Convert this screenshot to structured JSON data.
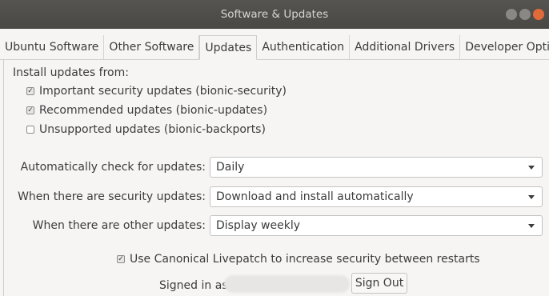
{
  "window": {
    "title": "Software & Updates"
  },
  "tabs": [
    {
      "label": "Ubuntu Software"
    },
    {
      "label": "Other Software"
    },
    {
      "label": "Updates",
      "active": true
    },
    {
      "label": "Authentication"
    },
    {
      "label": "Additional Drivers"
    },
    {
      "label": "Developer Options"
    }
  ],
  "updates": {
    "heading": "Install updates from:",
    "sources": [
      {
        "label": "Important security updates (bionic-security)",
        "checked": true
      },
      {
        "label": "Recommended updates (bionic-updates)",
        "checked": true
      },
      {
        "label": "Unsupported updates (bionic-backports)",
        "checked": false
      }
    ],
    "auto_check": {
      "label": "Automatically check for updates:",
      "value": "Daily"
    },
    "security": {
      "label": "When there are security updates:",
      "value": "Download and install automatically"
    },
    "other": {
      "label": "When there are other updates:",
      "value": "Display weekly"
    }
  },
  "livepatch": {
    "label": "Use Canonical Livepatch to increase security between restarts",
    "checked": true,
    "signed_in_label": "Signed in as",
    "sign_out_label": "Sign Out"
  }
}
